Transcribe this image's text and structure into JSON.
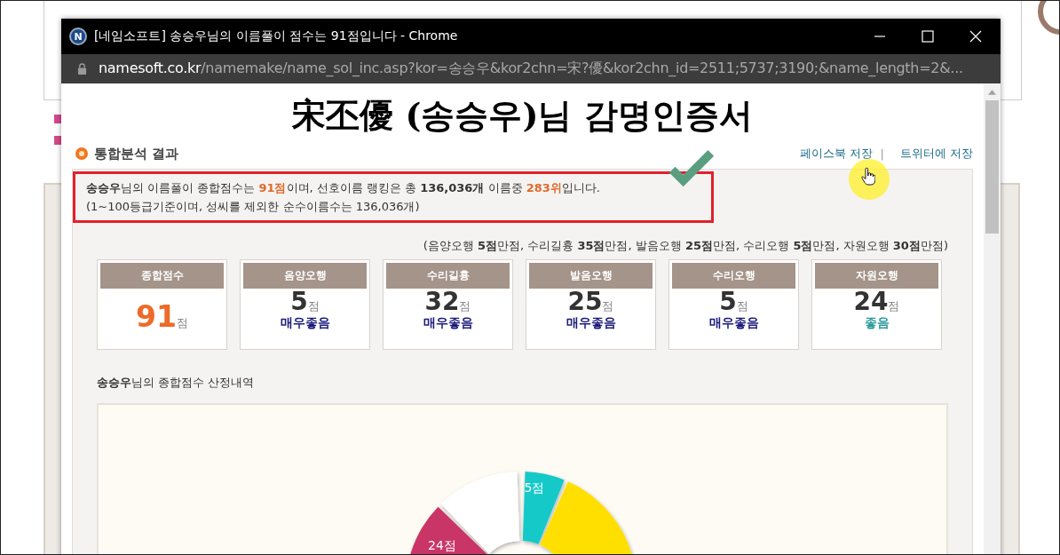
{
  "window": {
    "icon_letter": "N",
    "title": "[네임소프트] 송승우님의 이름풀이 점수는 91점입니다 - Chrome"
  },
  "address_bar": {
    "host": "namesoft.co.kr",
    "path": "/namemake/name_sol_inc.asp?kor=송승우&kor2chn=宋?優&kor2chn_id=2511;5737;3190;&name_length=2&..."
  },
  "certificate_title": "宋丕優 (송승우)님 감명인증서",
  "section_title": "통합분석 결과",
  "share_links": [
    {
      "label": "페이스북 저장"
    },
    {
      "label": "트위터에 저장"
    }
  ],
  "share_separator": "|",
  "summary": {
    "lines": [
      [
        {
          "text": "송승우",
          "kind": "bold"
        },
        {
          "text": "님의 이름풀이 종합점수는 ",
          "kind": "plain"
        },
        {
          "text": "91점",
          "kind": "highlight"
        },
        {
          "text": "이며, 선호이름 랭킹은 총 ",
          "kind": "plain"
        },
        {
          "text": "136,036개",
          "kind": "bold"
        },
        {
          "text": " 이름중 ",
          "kind": "plain"
        },
        {
          "text": "283위",
          "kind": "highlight"
        },
        {
          "text": "입니다.",
          "kind": "plain"
        }
      ],
      [
        {
          "text": "(1~100등급기준이며, 성씨를 제외한 순수이름수는 136,036개)",
          "kind": "plain"
        }
      ]
    ]
  },
  "criteria": "(음양오행 **5점**만점, 수리길흉 **35점**만점, 발음오행 **25점**만점, 수리오행 **5점**만점, 자원오행 **30점**만점)",
  "score_cards": [
    {
      "kind": "total",
      "label": "종합점수",
      "score": "91",
      "unit": "점"
    },
    {
      "kind": "element",
      "label": "음양오행",
      "score": "5",
      "unit": "점",
      "rating": "매우좋음",
      "color": "#1a1a7a"
    },
    {
      "kind": "element",
      "label": "수리길흉",
      "score": "32",
      "unit": "점",
      "rating": "매우좋음",
      "color": "#1a1a7a"
    },
    {
      "kind": "element",
      "label": "발음오행",
      "score": "25",
      "unit": "점",
      "rating": "매우좋음",
      "color": "#1a1a7a"
    },
    {
      "kind": "element",
      "label": "수리오행",
      "score": "5",
      "unit": "점",
      "rating": "매우좋음",
      "color": "#1a1a7a"
    },
    {
      "kind": "element",
      "label": "자원오행",
      "score": "24",
      "unit": "점",
      "rating": "좋음",
      "color": "#2a9a9a"
    }
  ],
  "chart_heading": "**송승우**님의 종합점수 산정내역",
  "chart_labels": [
    {
      "text": "5점"
    },
    {
      "text": "24점"
    }
  ]
}
